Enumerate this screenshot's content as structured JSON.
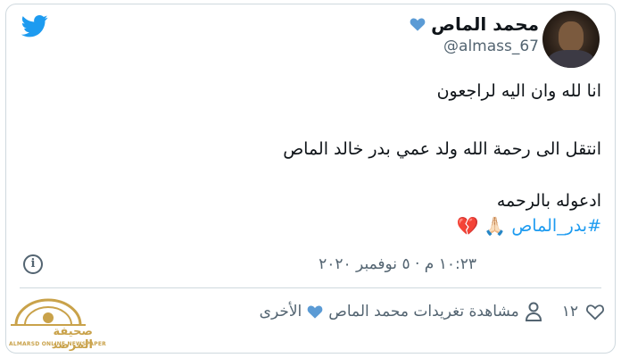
{
  "tweet": {
    "display_name": "محمد الماص",
    "handle": "@almass_67",
    "lines": [
      "انا لله وان اليه لراجعون",
      "انتقل الى رحمة الله ولد عمي بدر خالد الماص",
      "ادعوله بالرحمه"
    ],
    "hashtag": "#بدر_الماص",
    "emoji_hands": "🙏🏻",
    "emoji_heart": "💔",
    "timestamp": "١٠:٢٣ م · ٥ نوفمبر ٢٠٢٠",
    "info_glyph": "i"
  },
  "actions": {
    "like_count": "١٢",
    "more_tweets_prefix": "مشاهدة تغريدات محمد الماص",
    "more_tweets_suffix": "الأخرى"
  },
  "watermark": {
    "arabic": "صحيفة المرصد",
    "english": "ALMARSD ONLINE NEWSPAPER"
  },
  "colors": {
    "twitter_blue": "#1d9bf0",
    "secondary_text": "#536471",
    "primary_text": "#0f1419",
    "verified_heart": "#5b9bd5",
    "watermark_gold": "#c9a24a"
  },
  "icons": [
    "twitter-bird-icon",
    "blue-heart-icon",
    "info-icon",
    "heart-outline-icon",
    "person-icon"
  ]
}
